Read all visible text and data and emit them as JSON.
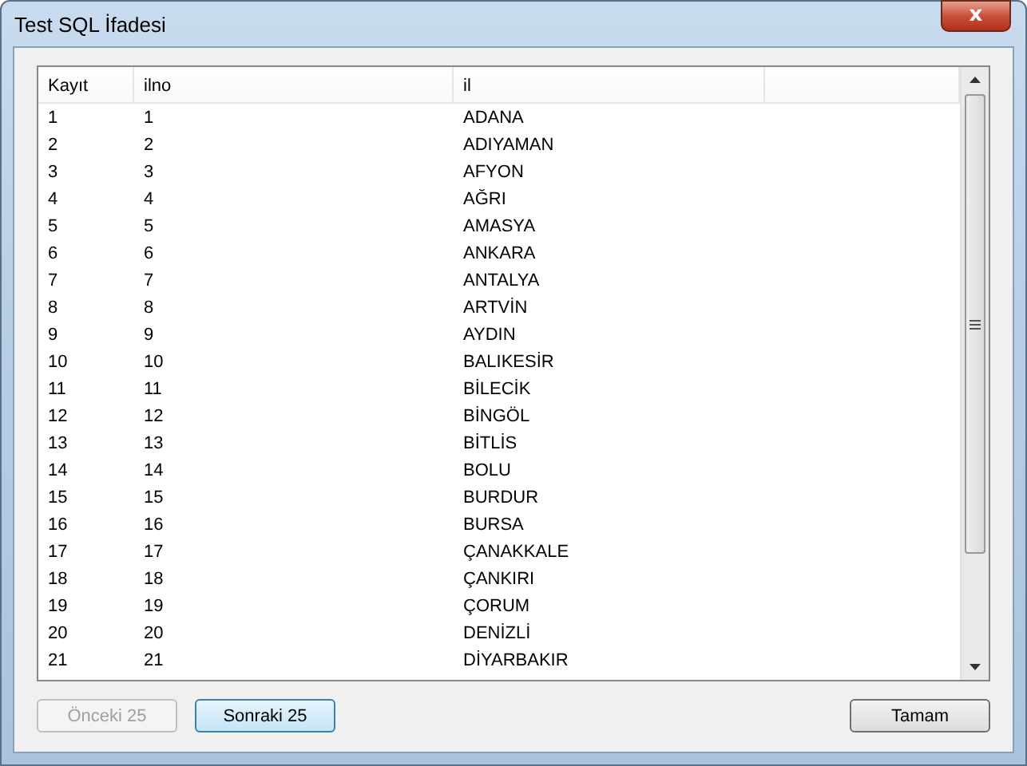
{
  "window": {
    "title": "Test SQL İfadesi",
    "close": "x"
  },
  "table": {
    "columns": [
      "Kayıt",
      "ilno",
      "il"
    ],
    "rows": [
      [
        "1",
        "1",
        "ADANA"
      ],
      [
        "2",
        "2",
        "ADIYAMAN"
      ],
      [
        "3",
        "3",
        "AFYON"
      ],
      [
        "4",
        "4",
        "AĞRI"
      ],
      [
        "5",
        "5",
        "AMASYA"
      ],
      [
        "6",
        "6",
        "ANKARA"
      ],
      [
        "7",
        "7",
        "ANTALYA"
      ],
      [
        "8",
        "8",
        "ARTVİN"
      ],
      [
        "9",
        "9",
        "AYDIN"
      ],
      [
        "10",
        "10",
        "BALIKESİR"
      ],
      [
        "11",
        "11",
        "BİLECİK"
      ],
      [
        "12",
        "12",
        "BİNGÖL"
      ],
      [
        "13",
        "13",
        "BİTLİS"
      ],
      [
        "14",
        "14",
        "BOLU"
      ],
      [
        "15",
        "15",
        "BURDUR"
      ],
      [
        "16",
        "16",
        "BURSA"
      ],
      [
        "17",
        "17",
        "ÇANAKKALE"
      ],
      [
        "18",
        "18",
        "ÇANKIRI"
      ],
      [
        "19",
        "19",
        "ÇORUM"
      ],
      [
        "20",
        "20",
        "DENİZLİ"
      ],
      [
        "21",
        "21",
        "DİYARBAKIR"
      ]
    ]
  },
  "buttons": [
    {
      "label": "Önceki 25",
      "disabled": true,
      "focused": false
    },
    {
      "label": "Sonraki 25",
      "disabled": false,
      "focused": true
    },
    {
      "label": "Tamam",
      "disabled": false,
      "focused": false
    }
  ]
}
